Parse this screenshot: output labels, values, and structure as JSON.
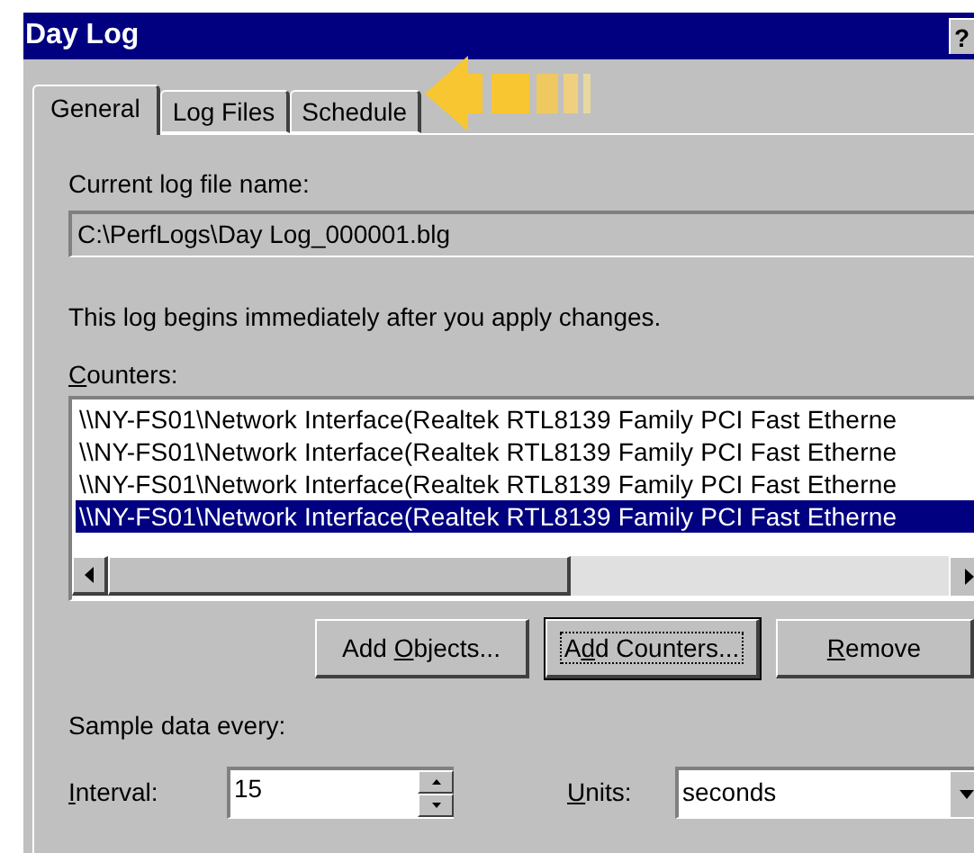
{
  "window": {
    "title": "Day Log",
    "help_button": "?"
  },
  "tabs": [
    {
      "label": "General",
      "selected": true
    },
    {
      "label": "Log Files",
      "selected": false
    },
    {
      "label": "Schedule",
      "selected": false
    }
  ],
  "log_file": {
    "label": "Current log file name:",
    "value": "C:\\PerfLogs\\Day Log_000001.blg"
  },
  "note": "This log begins immediately after you apply changes.",
  "counters": {
    "label": {
      "access_key": "C",
      "after": "ounters:"
    },
    "items": [
      {
        "text": "\\\\NY-FS01\\Network Interface(Realtek RTL8139 Family PCI Fast Etherne",
        "selected": false
      },
      {
        "text": "\\\\NY-FS01\\Network Interface(Realtek RTL8139 Family PCI Fast Etherne",
        "selected": false
      },
      {
        "text": "\\\\NY-FS01\\Network Interface(Realtek RTL8139 Family PCI Fast Etherne",
        "selected": false
      },
      {
        "text": "\\\\NY-FS01\\Network Interface(Realtek RTL8139 Family PCI Fast Etherne",
        "selected": true
      }
    ]
  },
  "buttons": [
    {
      "label": {
        "before": "Add ",
        "access_key": "O",
        "after": "bjects..."
      },
      "focused": false
    },
    {
      "label": {
        "before": "A",
        "access_key": "d",
        "after": "d Counters..."
      },
      "focused": true
    },
    {
      "label": {
        "access_key": "R",
        "after": "emove"
      },
      "focused": false
    }
  ],
  "sample": {
    "label": "Sample data every:",
    "interval": {
      "label": {
        "access_key": "I",
        "after": "nterval:"
      },
      "value": "15"
    },
    "units": {
      "label": {
        "access_key": "U",
        "after": "nits:"
      },
      "value": "seconds"
    }
  }
}
